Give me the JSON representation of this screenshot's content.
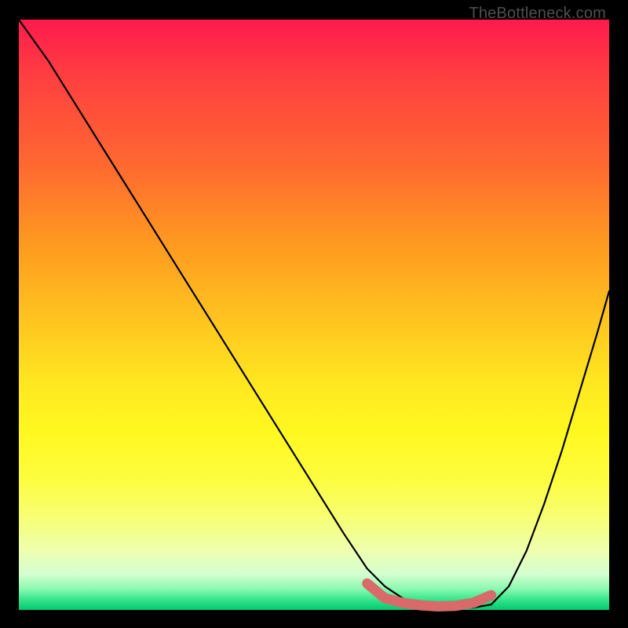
{
  "watermark": "TheBottleneck.com",
  "chart_data": {
    "type": "line",
    "title": "",
    "xlabel": "",
    "ylabel": "",
    "xlim": [
      0,
      100
    ],
    "ylim": [
      0,
      100
    ],
    "series": [
      {
        "name": "bottleneck-curve",
        "x": [
          0,
          5,
          10,
          15,
          20,
          25,
          30,
          35,
          40,
          45,
          50,
          55,
          59,
          62,
          65,
          68,
          71,
          74,
          77,
          80,
          83,
          86,
          89,
          92,
          95,
          98,
          100
        ],
        "values": [
          100,
          93,
          85,
          77,
          69,
          61,
          53,
          45,
          37,
          29,
          21,
          13,
          7,
          4,
          2,
          0.8,
          0.4,
          0.3,
          0.4,
          0.9,
          4,
          10,
          18,
          27,
          37,
          47,
          54
        ]
      }
    ],
    "optimal_zone": {
      "x": [
        59,
        62,
        65,
        68,
        71,
        74,
        77,
        80
      ],
      "values": [
        4.5,
        2,
        1.2,
        0.8,
        0.6,
        0.7,
        1.2,
        2.5
      ]
    }
  }
}
